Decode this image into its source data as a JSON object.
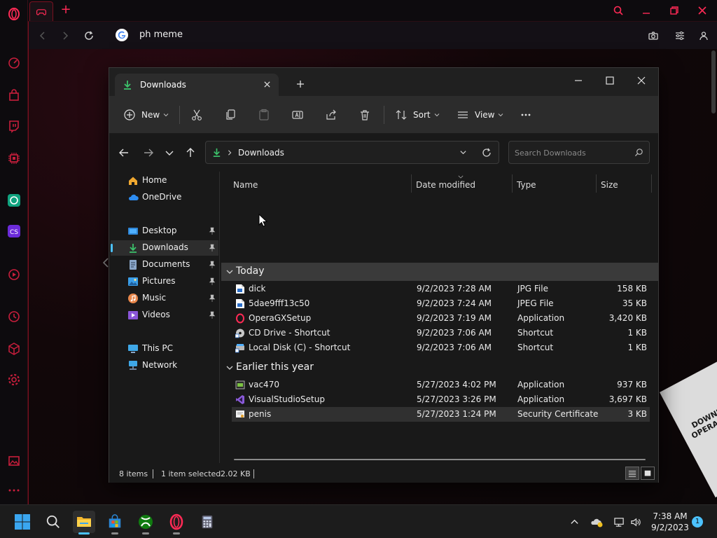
{
  "browser": {
    "url_text": "ph meme"
  },
  "explorer": {
    "tab_title": "Downloads",
    "toolbar": {
      "new_label": "New",
      "sort_label": "Sort",
      "view_label": "View"
    },
    "address": {
      "current": "Downloads",
      "search_placeholder": "Search Downloads"
    },
    "nav": [
      {
        "label": "Home",
        "icon": "home-icon"
      },
      {
        "label": "OneDrive",
        "icon": "cloud-icon"
      },
      {
        "label": "Desktop",
        "icon": "desktop-icon",
        "pinned": true
      },
      {
        "label": "Downloads",
        "icon": "download-icon",
        "pinned": true,
        "selected": true
      },
      {
        "label": "Documents",
        "icon": "document-icon",
        "pinned": true
      },
      {
        "label": "Pictures",
        "icon": "picture-icon",
        "pinned": true
      },
      {
        "label": "Music",
        "icon": "music-icon",
        "pinned": true
      },
      {
        "label": "Videos",
        "icon": "video-icon",
        "pinned": true
      },
      {
        "label": "This PC",
        "icon": "computer-icon"
      },
      {
        "label": "Network",
        "icon": "network-icon"
      }
    ],
    "columns": {
      "name": "Name",
      "date": "Date modified",
      "type": "Type",
      "size": "Size"
    },
    "groups": [
      {
        "label": "Today",
        "files": [
          {
            "name": "dick",
            "date": "9/2/2023 7:28 AM",
            "type": "JPG File",
            "size": "158 KB",
            "icon": "image-file-icon"
          },
          {
            "name": "5dae9fff13c50",
            "date": "9/2/2023 7:24 AM",
            "type": "JPEG File",
            "size": "35 KB",
            "icon": "image-file-icon"
          },
          {
            "name": "OperaGXSetup",
            "date": "9/2/2023 7:19 AM",
            "type": "Application",
            "size": "3,420 KB",
            "icon": "opera-gx-icon"
          },
          {
            "name": "CD Drive - Shortcut",
            "date": "9/2/2023 7:06 AM",
            "type": "Shortcut",
            "size": "1 KB",
            "icon": "cd-drive-icon"
          },
          {
            "name": "Local Disk (C) - Shortcut",
            "date": "9/2/2023 7:06 AM",
            "type": "Shortcut",
            "size": "1 KB",
            "icon": "hard-disk-icon"
          }
        ]
      },
      {
        "label": "Earlier this year",
        "files": [
          {
            "name": "vac470",
            "date": "5/27/2023 4:02 PM",
            "type": "Application",
            "size": "937 KB",
            "icon": "application-icon"
          },
          {
            "name": "VisualStudioSetup",
            "date": "5/27/2023 3:26 PM",
            "type": "Application",
            "size": "3,697 KB",
            "icon": "visual-studio-icon"
          },
          {
            "name": "penis",
            "date": "5/27/2023 1:24 PM",
            "type": "Security Certificate",
            "size": "3 KB",
            "icon": "certificate-icon",
            "selected": true
          }
        ]
      }
    ],
    "status": {
      "items": "8 items",
      "selected": "1 item selected",
      "size": "2.02 KB"
    }
  },
  "promo": {
    "text": "DOWNLOAD OPERA GX MO"
  },
  "taskbar": {
    "time": "7:38 AM",
    "date": "9/2/2023",
    "notifications": "1"
  },
  "colors": {
    "gx_accent": "#ff2a55",
    "explorer_bg": "#191919",
    "selection_accent": "#4cc2ff"
  }
}
